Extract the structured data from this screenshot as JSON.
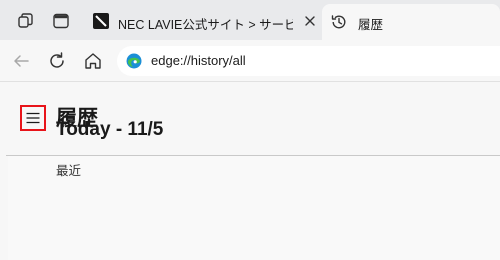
{
  "tabs": [
    {
      "title": "NEC LAVIE公式サイト > サービス＆サポート",
      "active": false,
      "icon": "nec-favicon"
    },
    {
      "title": "履歴",
      "active": true,
      "icon": "history-icon"
    }
  ],
  "toolbar": {
    "url": "edge://history/all"
  },
  "page": {
    "title": "履歴",
    "day_heading": "Today - 11/5",
    "section_label": "最近"
  },
  "colors": {
    "tabbar_bg": "#e9eaec",
    "page_bg": "#f7f7f7",
    "highlight": "#e8141a"
  }
}
